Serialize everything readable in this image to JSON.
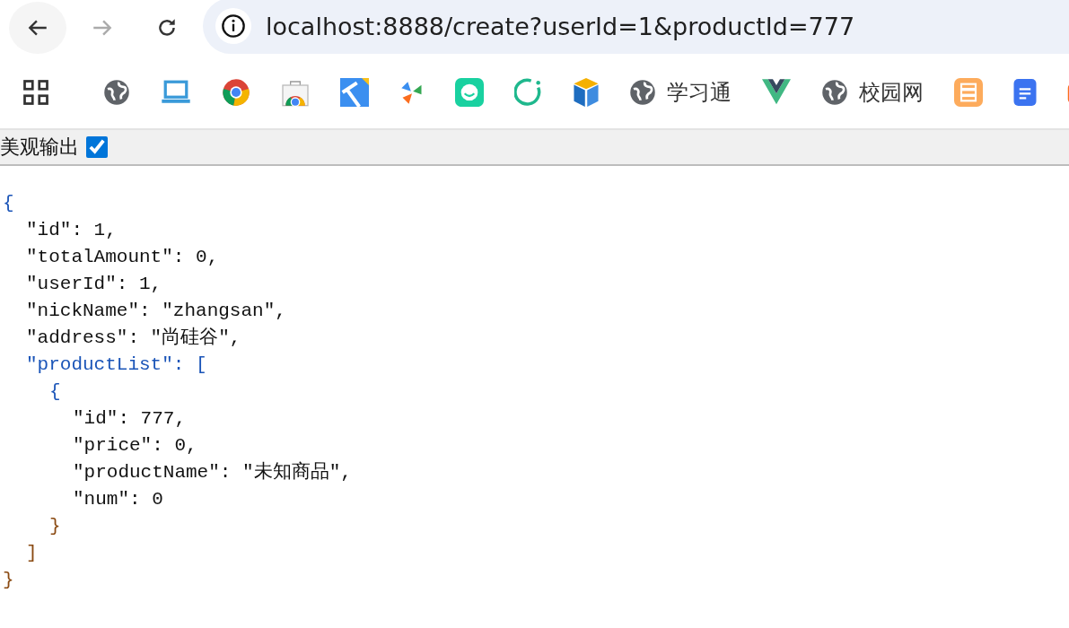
{
  "address_bar": {
    "url": "localhost:8888/create?userId=1&productId=777"
  },
  "bookmarks": [
    {
      "label": "学习通"
    },
    {
      "label": "校园网"
    }
  ],
  "viewer_bar": {
    "label": "美观输出",
    "checked": true
  },
  "json_output": {
    "text": "{",
    "close": "}",
    "children": [
      {
        "text": "\"id\": 1,"
      },
      {
        "text": "\"totalAmount\": 0,"
      },
      {
        "text": "\"userId\": 1,"
      },
      {
        "text": "\"nickName\": \"zhangsan\","
      },
      {
        "text": "\"address\": \"尚硅谷\","
      },
      {
        "text": "\"productList\": [",
        "close": "]",
        "children": [
          {
            "text": "{",
            "close": "}",
            "children": [
              {
                "text": "\"id\": 777,"
              },
              {
                "text": "\"price\": 0,"
              },
              {
                "text": "\"productName\": \"未知商品\","
              },
              {
                "text": "\"num\": 0"
              }
            ]
          }
        ]
      }
    ]
  }
}
